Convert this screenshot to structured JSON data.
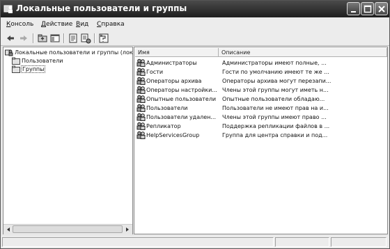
{
  "window": {
    "title": "Локальные пользователи и группы"
  },
  "menu": [
    {
      "label": "Консоль",
      "accel": "К",
      "rest": "онсоль"
    },
    {
      "label": "Действие",
      "accel": "Д",
      "rest": "ействие"
    },
    {
      "label": "Вид",
      "accel": "В",
      "rest": "ид"
    },
    {
      "label": "Справка",
      "accel": "С",
      "rest": "правка"
    }
  ],
  "toolbar": {
    "icons": [
      "back-arrow-icon",
      "forward-arrow-icon",
      "up-folder-icon",
      "show-hide-tree-icon",
      "properties-icon",
      "export-list-icon",
      "help-icon"
    ]
  },
  "tree": {
    "root_label": "Локальные пользователи и группы (лок",
    "items": [
      {
        "label": "Пользователи",
        "selected": false
      },
      {
        "label": "Группы",
        "selected": true
      }
    ]
  },
  "list": {
    "columns": {
      "name": "Имя",
      "description": "Описание"
    },
    "rows": [
      {
        "name": "Администраторы",
        "description": "Администраторы имеют полные, ..."
      },
      {
        "name": "Гости",
        "description": "Гости по умолчанию имеют те же ..."
      },
      {
        "name": "Операторы архива",
        "description": "Операторы архива могут перезапи..."
      },
      {
        "name": "Операторы настройки...",
        "description": "Члены этой группы могут иметь н..."
      },
      {
        "name": "Опытные пользователи",
        "description": "Опытные пользователи обладаю..."
      },
      {
        "name": "Пользователи",
        "description": "Пользователи не имеют прав на и..."
      },
      {
        "name": "Пользователи удален...",
        "description": "Члены этой группы имеют право ..."
      },
      {
        "name": "Репликатор",
        "description": "Поддержка репликации файлов в ..."
      },
      {
        "name": "HelpServicesGroup",
        "description": "Группа для центра справки и под..."
      }
    ]
  },
  "colors": {
    "titlebar": "#2a2a2a",
    "chrome": "#ececec",
    "window_bg": "#ffffff"
  }
}
